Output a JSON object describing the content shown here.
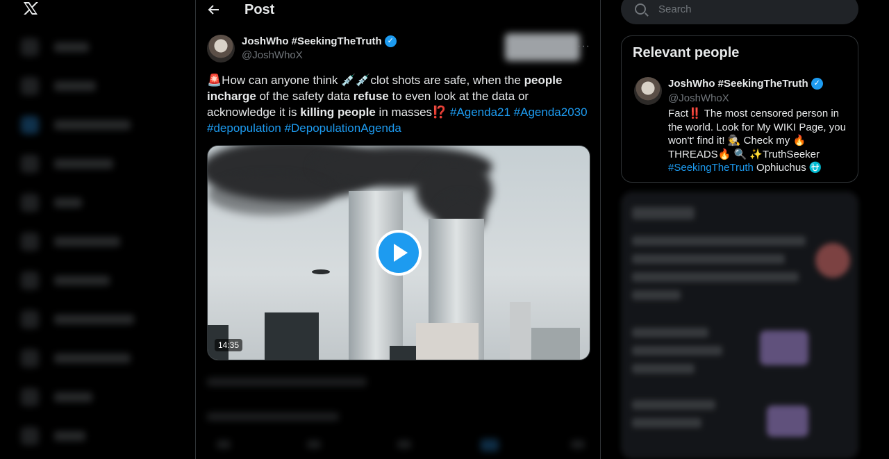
{
  "nav": {
    "logo_icon": "x-logo-icon"
  },
  "header": {
    "back_icon": "arrow-left-icon",
    "title": "Post"
  },
  "post": {
    "author_name": "JoshWho #SeekingTheTruth",
    "author_handle": "@JoshWhoX",
    "verified": "✓",
    "more": "···",
    "text_parts": {
      "p1": "🚨How can anyone think 💉💉clot shots are safe, when the ",
      "b1": "people incharge",
      "p2": " of the safety data ",
      "b2": "refuse",
      "p3": " to even look at the data or acknowledge it is ",
      "b3": "killing people",
      "p4": " in masses⁉️ ",
      "t1": "#Agenda21",
      "t2": "#Agenda2030",
      "t3": "#depopulation",
      "t4": "#DepopulationAgenda"
    },
    "video": {
      "duration": "14:35",
      "play_icon": "play-icon"
    }
  },
  "search": {
    "placeholder": "Search"
  },
  "relevant_people": {
    "title": "Relevant people",
    "name": "JoshWho #SeekingTheTruth",
    "handle": "@JoshWhoX",
    "verified": "✓",
    "bio": {
      "b1": "Fact‼️ The most censored person in the world. Look for My WIKI Page, you won't' find it! 🕵️ Check my 🔥 THREADS🔥 🔍 ✨TruthSeeker ",
      "tag": "#SeekingTheTruth",
      "b2": " Ophiuchus ⛎"
    }
  },
  "colors": {
    "accent": "#1d9bf0",
    "background": "#000000",
    "text": "#e7e9ea",
    "muted": "#71767b",
    "border": "#2f3336"
  }
}
